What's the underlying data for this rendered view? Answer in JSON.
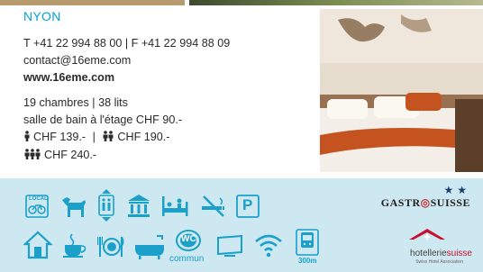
{
  "city": "NYON",
  "contact": {
    "phone_fax": "T +41 22 994 88 00 | F +41 22 994 88 09",
    "email": "contact@16eme.com",
    "website": "www.16eme.com"
  },
  "rooms": {
    "summary": "19 chambres | 38 lits",
    "bathroom": "salle de bain à l'étage CHF 90.-",
    "single_price": "CHF 139.-",
    "separator": "|",
    "double_price": "CHF 190.-",
    "triple_price": "CHF 240.-"
  },
  "amenities": [
    {
      "name": "local-bike-icon",
      "label": "LOCAL"
    },
    {
      "name": "dog-icon"
    },
    {
      "name": "elevator-icon"
    },
    {
      "name": "museum-icon"
    },
    {
      "name": "family-bed-icon"
    },
    {
      "name": "no-smoking-icon"
    },
    {
      "name": "parking-icon",
      "label": "P"
    },
    {
      "name": "house-icon"
    },
    {
      "name": "coffee-cup-icon"
    },
    {
      "name": "plate-cutlery-icon"
    },
    {
      "name": "bathtub-icon"
    },
    {
      "name": "wc-icon",
      "label": "WC",
      "sub": "commun"
    },
    {
      "name": "tv-icon"
    },
    {
      "name": "wifi-icon"
    },
    {
      "name": "train-icon",
      "sub": "300m"
    }
  ],
  "badges": {
    "stars": "★★",
    "gastro_left": "GASTR",
    "gastro_right": "SUISSE",
    "hotellerie_a": "hotellerie",
    "hotellerie_b": "suisse",
    "hotellerie_sub": "Swiss Hotel Association"
  },
  "colors": {
    "accent": "#00a3d0",
    "band": "#cde8f1",
    "icon": "#1aa0c9"
  }
}
